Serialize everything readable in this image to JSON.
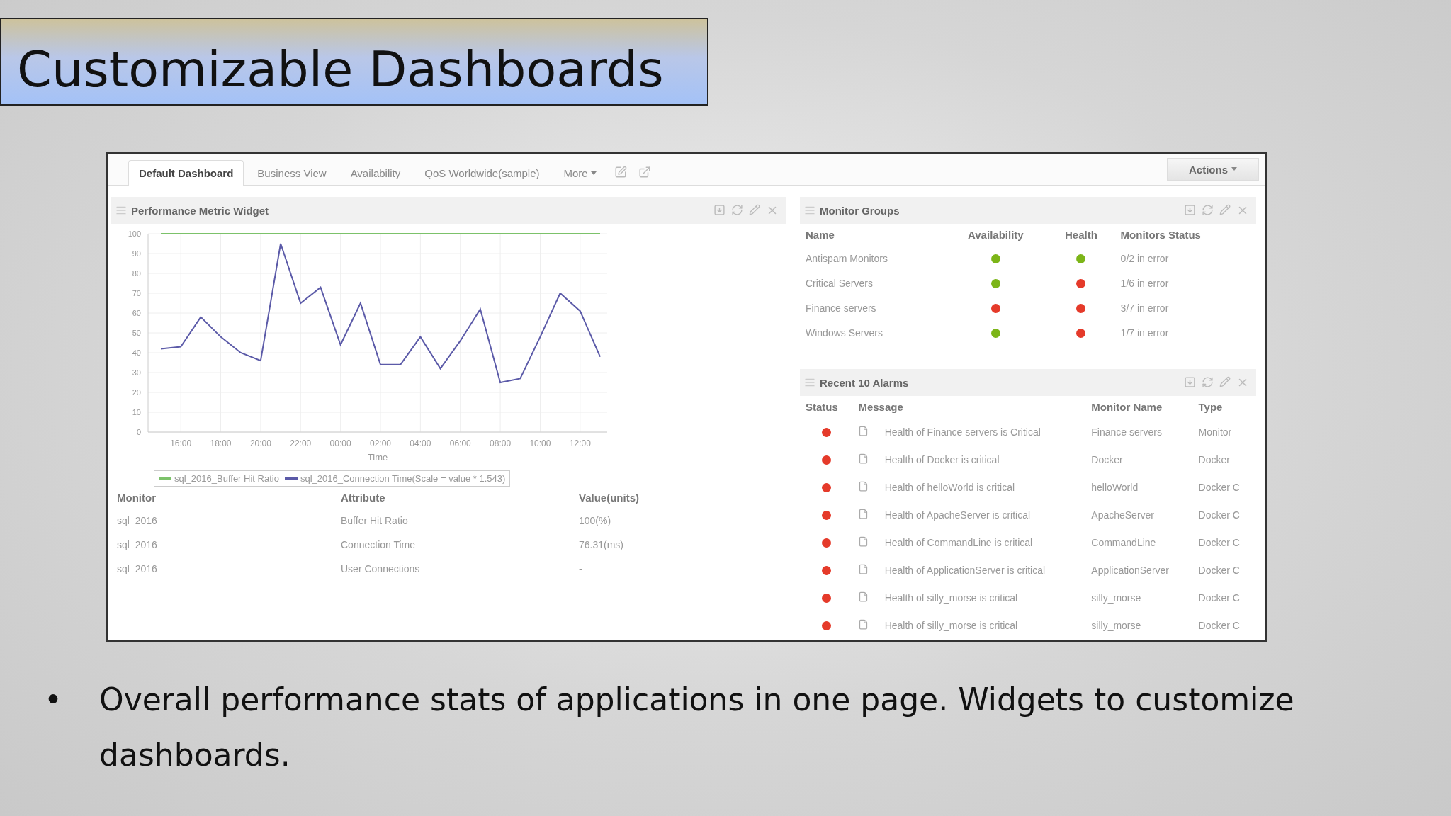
{
  "slide_title": "Customizable Dashboards",
  "app": {
    "tabs": [
      {
        "label": "Default Dashboard",
        "selected": true
      },
      {
        "label": "Business View",
        "selected": false
      },
      {
        "label": "Availability",
        "selected": false
      },
      {
        "label": "QoS Worldwide(sample)",
        "selected": false
      },
      {
        "label": "More",
        "selected": false
      }
    ],
    "actions_button": "Actions",
    "performance_widget": {
      "title": "Performance Metric Widget",
      "chart_data": {
        "type": "line",
        "xlabel": "Time",
        "grid": true,
        "categories": [
          null,
          "16:00",
          null,
          "18:00",
          null,
          "20:00",
          null,
          "22:00",
          null,
          "00:00",
          null,
          "02:00",
          null,
          "04:00",
          null,
          "06:00",
          null,
          "08:00",
          null,
          "10:00",
          null,
          "12:00",
          null
        ],
        "ylim": [
          0,
          100
        ],
        "yticks": [
          0,
          10,
          20,
          30,
          40,
          50,
          60,
          70,
          80,
          90,
          100
        ],
        "series": [
          {
            "name": "sql_2016_Buffer Hit Ratio",
            "color": "#7cc26a",
            "values": [
              100,
              100,
              100,
              100,
              100,
              100,
              100,
              100,
              100,
              100,
              100,
              100,
              100,
              100,
              100,
              100,
              100,
              100,
              100,
              100,
              100,
              100,
              100
            ]
          },
          {
            "name": "sql_2016_Connection Time(Scale = value * 1.543)",
            "color": "#5b5aa8",
            "values": [
              42,
              43,
              58,
              48,
              40,
              36,
              95,
              65,
              73,
              44,
              65,
              34,
              34,
              48,
              32,
              46,
              62,
              25,
              27,
              48,
              70,
              61,
              38
            ]
          }
        ]
      },
      "columns": [
        "Monitor",
        "Attribute",
        "Value(units)"
      ],
      "rows": [
        [
          "sql_2016",
          "Buffer Hit Ratio",
          "100(%)"
        ],
        [
          "sql_2016",
          "Connection Time",
          "76.31(ms)"
        ],
        [
          "sql_2016",
          "User Connections",
          "-"
        ]
      ]
    },
    "monitor_groups": {
      "title": "Monitor Groups",
      "columns": [
        "Name",
        "Availability",
        "Health",
        "Monitors Status"
      ],
      "rows": [
        {
          "name": "Antispam Monitors",
          "availability": {
            "color": "#7cb518"
          },
          "health": {
            "color": "#7cb518"
          },
          "status": "0/2 in error"
        },
        {
          "name": "Critical Servers",
          "availability": {
            "color": "#7cb518"
          },
          "health": {
            "color": "#e53a2a"
          },
          "status": "1/6 in error"
        },
        {
          "name": "Finance servers",
          "availability": {
            "color": "#e53a2a"
          },
          "health": {
            "color": "#e53a2a"
          },
          "status": "3/7 in error"
        },
        {
          "name": "Windows Servers",
          "availability": {
            "color": "#7cb518"
          },
          "health": {
            "color": "#e53a2a"
          },
          "status": "1/7 in error"
        }
      ]
    },
    "recent_alarms": {
      "title": "Recent 10 Alarms",
      "columns": [
        "Status",
        "Message",
        "Monitor Name",
        "Type"
      ],
      "rows": [
        {
          "color": "#e53a2a",
          "message": "Health of Finance servers is Critical",
          "monitor": "Finance servers",
          "type": "Monitor"
        },
        {
          "color": "#e53a2a",
          "message": "Health of Docker is critical",
          "monitor": "Docker",
          "type": "Docker"
        },
        {
          "color": "#e53a2a",
          "message": "Health of helloWorld is critical",
          "monitor": "helloWorld",
          "type": "Docker C"
        },
        {
          "color": "#e53a2a",
          "message": "Health of ApacheServer is critical",
          "monitor": "ApacheServer",
          "type": "Docker C"
        },
        {
          "color": "#e53a2a",
          "message": "Health of CommandLine is critical",
          "monitor": "CommandLine",
          "type": "Docker C"
        },
        {
          "color": "#e53a2a",
          "message": "Health of ApplicationServer is critical",
          "monitor": "ApplicationServer",
          "type": "Docker C"
        },
        {
          "color": "#e53a2a",
          "message": "Health of silly_morse is critical",
          "monitor": "silly_morse",
          "type": "Docker C"
        },
        {
          "color": "#e53a2a",
          "message": "Health of silly_morse is critical",
          "monitor": "silly_morse",
          "type": "Docker C"
        }
      ]
    }
  },
  "bullets": [
    {
      "marker": "•",
      "text": "Overall performance stats of applications in one page. Widgets to customize dashboards."
    }
  ]
}
